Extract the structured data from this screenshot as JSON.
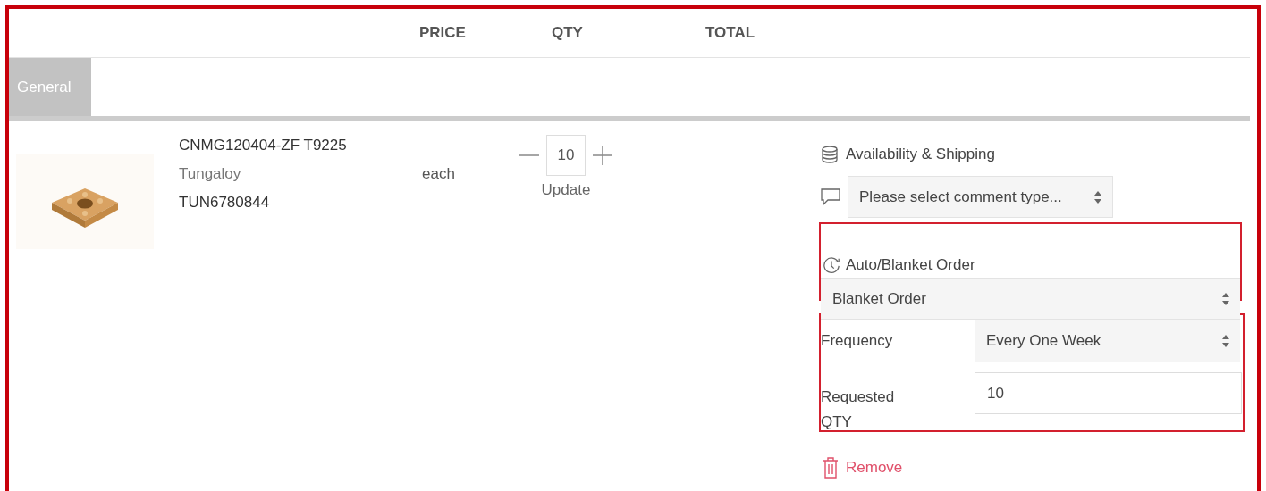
{
  "columns": [
    "PRICE",
    "QTY",
    "TOTAL"
  ],
  "tabs": [
    {
      "label": "General",
      "selected": true
    }
  ],
  "item": {
    "name": "CNMG120404-ZF T9225",
    "brand": "Tungaloy",
    "sku": "TUN6780844",
    "unit": "each",
    "quantity": "10",
    "update": "Update"
  },
  "availability": "Availability & Shipping",
  "comment_select": {
    "placeholder": "Please select comment type..."
  },
  "order_type": {
    "label": "Auto/Blanket Order",
    "value": "Blanket Order"
  },
  "frequency": {
    "label": "Frequency",
    "value": "Every One Week"
  },
  "requested_qty": {
    "label": "Requested QTY",
    "value": "10"
  },
  "remove": "Remove"
}
